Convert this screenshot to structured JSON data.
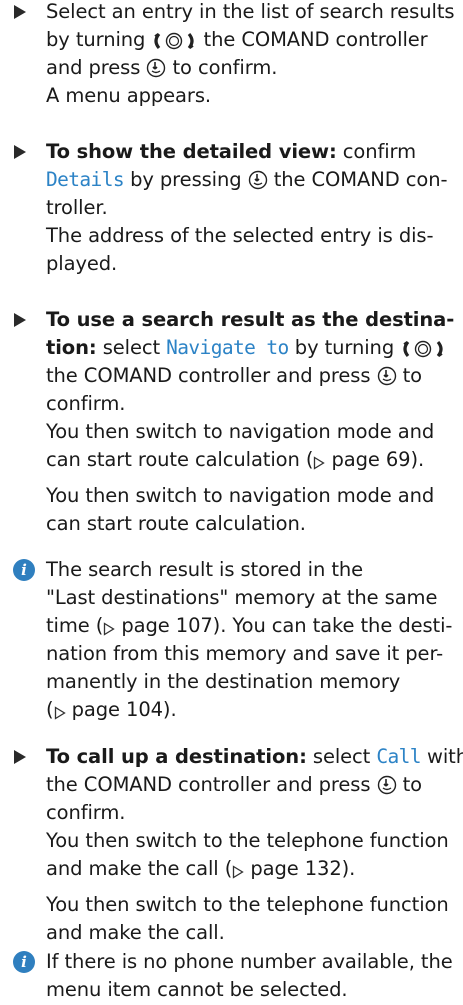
{
  "icons": {
    "arrow": "triangle-bullet-icon",
    "info": "info-icon",
    "turn": "turn-controller-icon",
    "press": "press-controller-icon",
    "page_ref": "page-reference-triangle-icon"
  },
  "colors": {
    "accent": "#2c83c6",
    "info_bg": "#2f7fbf",
    "text": "#1a1a1a"
  },
  "s1": {
    "l1": "Select an entry in the list of search results",
    "l2a": "by turning ",
    "l2b": " the COMAND controller",
    "l3a": "and press ",
    "l3b": " to confirm.",
    "l4": "A menu appears."
  },
  "s2": {
    "bold": "To show the detailed view:",
    "l1b": " confirm",
    "menu": "Details",
    "l2b": " by pressing ",
    "l2c": " the COMAND con-",
    "l3": "troller.",
    "l4": "The address of the selected entry is dis-",
    "l5": "played."
  },
  "s3": {
    "bold1": "To use a search result as the destina-",
    "bold2": "tion:",
    "l2a": " select ",
    "menu": "Navigate to",
    "l2b": " by turning ",
    "l3a": "the COMAND controller and press ",
    "l3b": " to",
    "l4": "confirm.",
    "l5": "You then switch to navigation mode and",
    "l6a": "can start route calculation (",
    "l6b": " page 69).",
    "l7": "You then switch to navigation mode and",
    "l8": "can start route calculation."
  },
  "info1": {
    "l1": "The search result is stored in the",
    "l2": "\"Last destinations\" memory at the same",
    "l3a": "time (",
    "l3b": " page 107). You can take the desti-",
    "l4": "nation from this memory and save it per-",
    "l5": "manently in the destination memory",
    "l6a": "(",
    "l6b": " page 104)."
  },
  "s4": {
    "bold": "To call up a destination:",
    "l1b": " select ",
    "menu": "Call",
    "l1c": " with",
    "l2a": "the COMAND controller and press ",
    "l2b": " to",
    "l3": "confirm.",
    "l4": "You then switch to the telephone function",
    "l5a": "and make the call (",
    "l5b": " page 132).",
    "l6": "You then switch to the telephone function",
    "l7": "and make the call."
  },
  "info2": {
    "l1": "If there is no phone number available, the",
    "l2": "menu item cannot be selected."
  }
}
